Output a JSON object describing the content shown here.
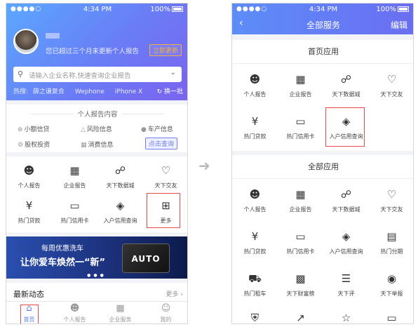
{
  "left": {
    "status": {
      "signal": "●●●●○",
      "time": "4:34 PM",
      "battery": "100%"
    },
    "profile": {
      "notice": "您已超过三个月未更新个人报告",
      "update_btn": "立即更新"
    },
    "search": {
      "placeholder": "请输入企业名称,快速查询企业报告"
    },
    "hot": {
      "label": "热搜:",
      "items": [
        "薛之谦复合",
        "Wephone",
        "iPhone X"
      ],
      "change": "换一批"
    },
    "personal": {
      "title": "个人报告内容",
      "items": [
        "小额信贷",
        "风险信息",
        "车产信息",
        "股权投资",
        "消费信息"
      ],
      "query_btn": "点击查询"
    },
    "services": [
      "个人报告",
      "企业报告",
      "天下数据城",
      "天下交友",
      "热门贷款",
      "热门信用卡",
      "入户信用查询",
      "更多"
    ],
    "banner": {
      "line1": "每周优惠洗车",
      "line2": "让你爱车焕然一“新”",
      "card": "AUTO"
    },
    "news": {
      "title": "最新动态",
      "more": "更多"
    },
    "tabs": [
      "首页",
      "个人报告",
      "企业服务",
      "我的"
    ]
  },
  "right": {
    "status": {
      "signal": "●●●●○",
      "time": "4:34 PM",
      "battery": "100%"
    },
    "nav": {
      "back": "‹",
      "title": "全部服务",
      "edit": "编辑"
    },
    "home_section": {
      "title": "首页应用",
      "items": [
        "个人报告",
        "企业报告",
        "天下数据城",
        "天下交友",
        "热门贷款",
        "热门信用卡",
        "入户信用查询"
      ]
    },
    "all_section": {
      "title": "全部应用",
      "items": [
        "个人报告",
        "企业报告",
        "天下数据城",
        "天下交友",
        "热门贷款",
        "热门信用卡",
        "入户信用查询",
        "热门分期",
        "热门租车",
        "天下财富榜",
        "天下评",
        "天下举报"
      ]
    }
  },
  "accent": "#5b7ef5",
  "highlight": "#e84a4a"
}
